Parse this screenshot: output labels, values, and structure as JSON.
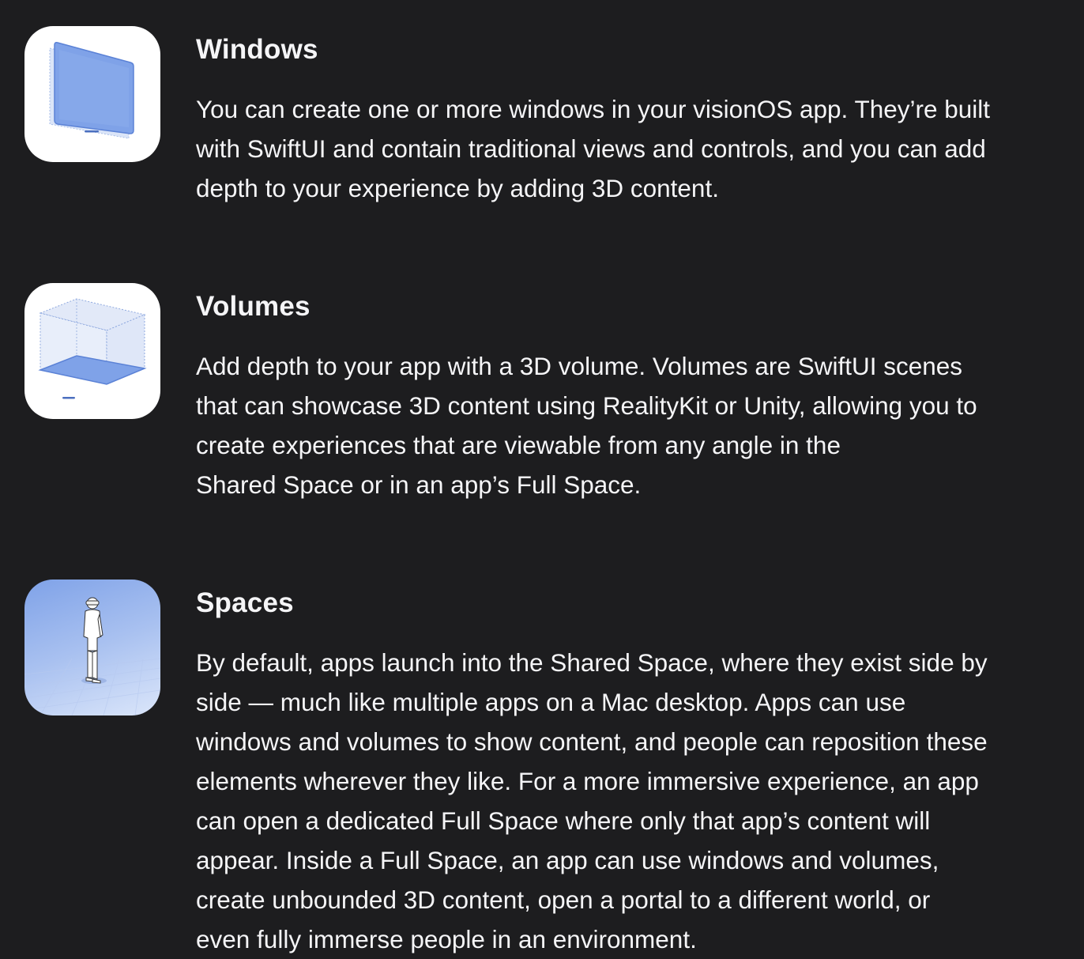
{
  "sections": [
    {
      "title": "Windows",
      "icon": "window-icon",
      "body_lines": [
        "You can create one or more windows in your visionOS app. They’re built",
        "with SwiftUI and contain traditional views and controls, and you can add",
        "depth to your experience by adding 3D content."
      ]
    },
    {
      "title": "Volumes",
      "icon": "volume-cube-icon",
      "body_lines": [
        "Add depth to your app with a 3D volume. Volumes are SwiftUI scenes",
        "that can showcase 3D content using RealityKit or Unity, allowing you to",
        "create experiences that are viewable from any angle in the",
        "Shared Space or in an app’s Full Space."
      ]
    },
    {
      "title": "Spaces",
      "icon": "person-in-space-icon",
      "body_lines": [
        "By default, apps launch into the Shared Space, where they exist side by",
        "side — much like multiple apps on a Mac desktop. Apps can use",
        "windows and volumes to show content, and people can reposition these",
        "elements wherever they like. For a more immersive experience, an app",
        "can open a dedicated Full Space where only that app’s content will",
        "appear. Inside a Full Space, an app can use windows and volumes,",
        "create unbounded 3D content, open a portal to a different world, or",
        "even fully immerse people in an environment."
      ]
    }
  ],
  "colors": {
    "background": "#1d1d1f",
    "text": "#f5f5f7",
    "icon_blue": "#7fa2e8"
  }
}
